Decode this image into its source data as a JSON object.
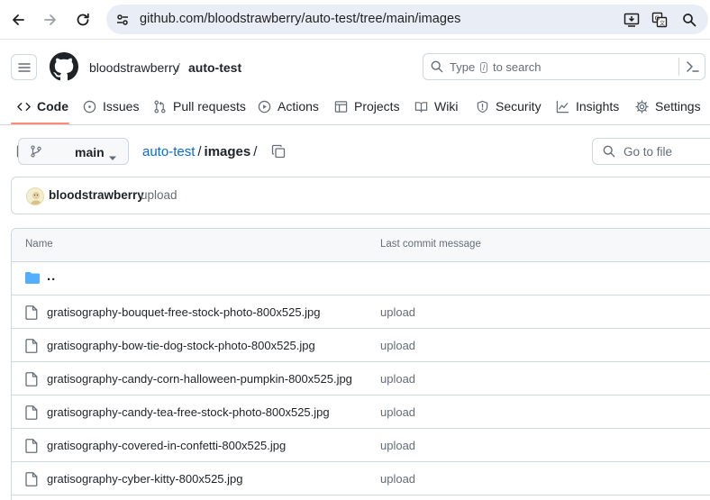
{
  "browser": {
    "url": "github.com/bloodstrawberry/auto-test/tree/main/images"
  },
  "header": {
    "owner": "bloodstrawberry",
    "separator": "/",
    "repo": "auto-test",
    "search": {
      "prefix": "Type",
      "key": "/",
      "suffix": "to search"
    }
  },
  "tabs": [
    {
      "label": "Code",
      "icon": "code-icon"
    },
    {
      "label": "Issues",
      "icon": "issue-opened-icon"
    },
    {
      "label": "Pull requests",
      "icon": "git-pull-request-icon"
    },
    {
      "label": "Actions",
      "icon": "play-icon"
    },
    {
      "label": "Projects",
      "icon": "table-icon"
    },
    {
      "label": "Wiki",
      "icon": "book-icon"
    },
    {
      "label": "Security",
      "icon": "shield-icon"
    },
    {
      "label": "Insights",
      "icon": "graph-icon"
    },
    {
      "label": "Settings",
      "icon": "gear-icon"
    }
  ],
  "path_bar": {
    "branch": "main",
    "repo_link": "auto-test",
    "separator": "/",
    "dir": "images",
    "trailing": "/",
    "go_to_file": "Go to file"
  },
  "commit": {
    "author": "bloodstrawberry",
    "message": "upload"
  },
  "table": {
    "col_name": "Name",
    "col_message": "Last commit message",
    "parent": "..",
    "rows": [
      {
        "name": "gratisography-bouquet-free-stock-photo-800x525.jpg",
        "message": "upload"
      },
      {
        "name": "gratisography-bow-tie-dog-stock-photo-800x525.jpg",
        "message": "upload"
      },
      {
        "name": "gratisography-candy-corn-halloween-pumpkin-800x525.jpg",
        "message": "upload"
      },
      {
        "name": "gratisography-candy-tea-free-stock-photo-800x525.jpg",
        "message": "upload"
      },
      {
        "name": "gratisography-covered-in-confetti-800x525.jpg",
        "message": "upload"
      },
      {
        "name": "gratisography-cyber-kitty-800x525.jpg",
        "message": "upload"
      }
    ]
  },
  "colors": {
    "link": "#0969da",
    "active_tab_underline": "#fd8c73",
    "folder": "#54aeff",
    "muted_text": "#656d76",
    "border": "#d0d7de"
  }
}
